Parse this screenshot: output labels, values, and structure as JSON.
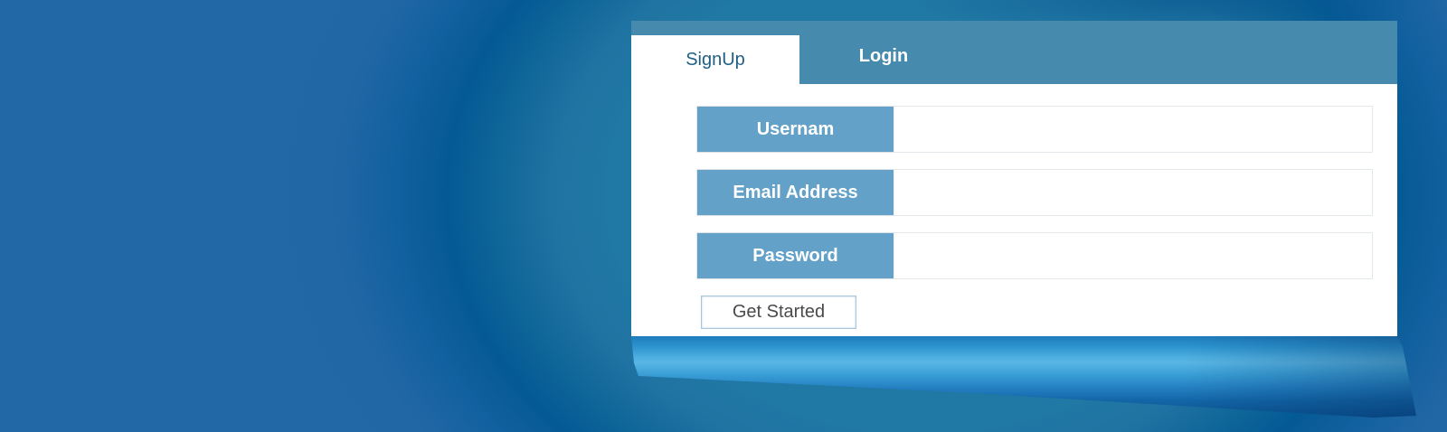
{
  "tabs": {
    "signup_label": "SignUp",
    "login_label": "Login"
  },
  "form": {
    "username_label": "Usernam",
    "username_value": "",
    "email_label": "Email Address",
    "email_value": "",
    "password_label": "Password",
    "password_value": "",
    "submit_label": "Get Started"
  },
  "colors": {
    "tab_bar": "#468aad",
    "field_label_bg": "#63a1c9",
    "active_tab_text": "#1f5f85",
    "background": "#2368a6"
  }
}
